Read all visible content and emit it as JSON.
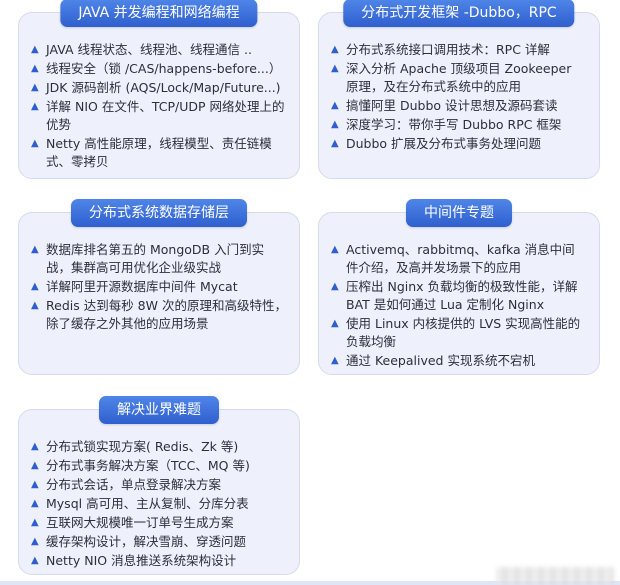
{
  "cards": {
    "java": {
      "title": "JAVA 并发编程和网络编程",
      "items": [
        "JAVA 线程状态、线程池、线程通信 ..",
        "线程安全（锁 /CAS/happens-before...）",
        "JDK 源码剖析 (AQS/Lock/Map/Future...)",
        "详解 NIO 在文件、TCP/UDP 网络处理上的优势",
        "Netty 高性能原理，线程模型、责任链模式、零拷贝"
      ]
    },
    "dubbo": {
      "title": "分布式开发框架 -Dubbo，RPC",
      "items": [
        "分布式系统接口调用技术：RPC 详解",
        "深入分析 Apache 顶级项目 Zookeeper 原理，及在分布式系统中的应用",
        "搞懂阿里 Dubbo 设计思想及源码套读",
        "深度学习：带你手写 Dubbo RPC 框架",
        "Dubbo 扩展及分布式事务处理问题"
      ]
    },
    "storage": {
      "title": "分布式系统数据存储层",
      "items": [
        "数据库排名第五的 MongoDB 入门到实战，集群高可用优化企业级实战",
        "详解阿里开源数据库中间件 Mycat",
        "Redis 达到每秒 8W 次的原理和高级特性，除了缓存之外其他的应用场景"
      ]
    },
    "middleware": {
      "title": "中间件专题",
      "items": [
        "Activemq、rabbitmq、kafka 消息中间件介绍，及高并发场景下的应用",
        "压榨出 Nginx 负载均衡的极致性能，详解BAT 是如何通过 Lua 定制化 Nginx",
        "使用 Linux 内核提供的 LVS 实现高性能的负载均衡",
        "通过 Keepalived 实现系统不宕机"
      ]
    },
    "solutions": {
      "title": "解决业界难题",
      "items": [
        "分布式锁实现方案( Redis、Zk 等)",
        "分布式事务解决方案（TCC、MQ 等)",
        "分布式会话，单点登录解决方案",
        "Mysql 高可用、主从复制、分库分表",
        "互联网大规模唯一订单号生成方案",
        "缓存架构设计，解决雪崩、穿透问题",
        "Netty NIO 消息推送系统架构设计"
      ]
    }
  },
  "bullet_glyph": "▲",
  "colors": {
    "card_bg": "#eef1fb",
    "badge": "#3a6fdc",
    "bullet": "#2f5fce"
  }
}
